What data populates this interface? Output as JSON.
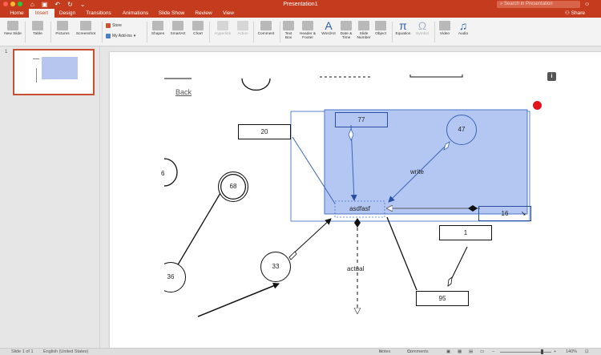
{
  "window": {
    "title": "Presentation1",
    "search_placeholder": "Search in Presentation",
    "share_label": "Share",
    "close_color": "#ff5f57",
    "min_color": "#febc2e",
    "max_color": "#28c840"
  },
  "tabs": [
    "Home",
    "Insert",
    "Design",
    "Transitions",
    "Animations",
    "Slide Show",
    "Review",
    "View"
  ],
  "active_tab": "Insert",
  "ribbon": {
    "new_slide": "New Slide",
    "table": "Table",
    "pictures": "Pictures",
    "screenshot": "Screenshot",
    "store": "Store",
    "my_addins": "My Add-ins",
    "shapes": "Shapes",
    "smartart": "SmartArt",
    "chart": "Chart",
    "hyperlink": "Hyperlink",
    "action": "Action",
    "comment": "Comment",
    "text_box": "Text Box",
    "header_footer": "Header & Footer",
    "wordart": "WordArt",
    "date_time": "Date & Time",
    "slide_number": "Slide Number",
    "object": "Object",
    "equation": "Equation",
    "symbol": "Symbol",
    "video": "Video",
    "audio": "Audio"
  },
  "thumbnails": [
    {
      "number": "1"
    }
  ],
  "slide": {
    "back_link": "Back",
    "info_glyph": "i",
    "nodes": {
      "n77": "77",
      "n47": "47",
      "n20": "20",
      "n68": "68",
      "n36": "36",
      "n33": "33",
      "n1": "1",
      "n95": "95",
      "n16": "16",
      "asdfasf": "asdfasf"
    },
    "labels": {
      "write": "write",
      "actual": "actual"
    },
    "selection_color": "#b4c7f2",
    "selection_border": "#4a76c9"
  },
  "status": {
    "slide_of": "Slide 1 of 1",
    "language": "English (United States)",
    "notes": "Notes",
    "comments": "Comments",
    "zoom": "140%"
  }
}
